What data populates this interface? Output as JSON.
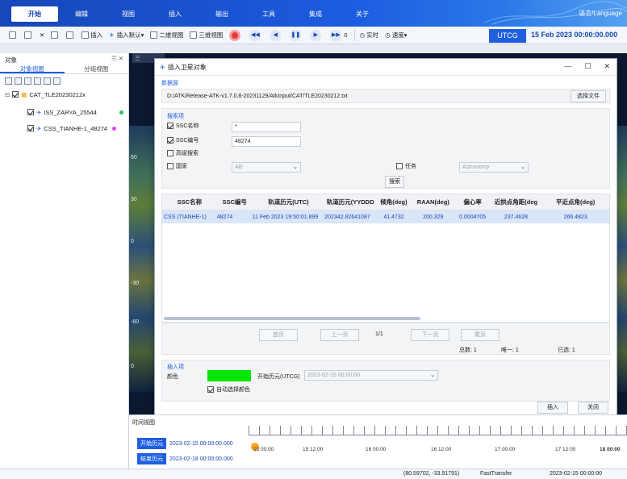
{
  "menubar": {
    "tabs": [
      "开始",
      "编辑",
      "视图",
      "插入",
      "输出",
      "工具",
      "集成",
      "关于"
    ],
    "active_tab": "开始",
    "language_label": "语言/Language"
  },
  "toolbar": {
    "insert_label": "插入",
    "insert_default_label": "插入默认▾",
    "view2d_label": "二维视图",
    "view3d_label": "三维视图",
    "step_value": "0",
    "realtime_label": "实时",
    "speed_label": "速度▾",
    "time_system": "UTCG",
    "current_time": "15 Feb 2023 00:00:00.000"
  },
  "object_panel": {
    "title": "对象",
    "tabs": [
      "对象视图",
      "分组视图"
    ],
    "tree": {
      "catalog": "CAT_TLE20230212x",
      "items": [
        {
          "name": "ISS_ZARYA_25544",
          "color": "#22c55e"
        },
        {
          "name": "CSS_TIANHE-1_48274",
          "color": "#d946ef"
        }
      ]
    }
  },
  "viewport": {
    "tab": "三",
    "lat_labels": [
      "60",
      "30",
      "0",
      "-30",
      "-60",
      "0"
    ]
  },
  "dialog": {
    "title": "插入卫星对象",
    "datasource": {
      "section": "数据源",
      "path": "D:/ATK/Release-ATK-v1.7.0.8-20231129/AtkInput/CAT/TLE20230212.txt",
      "choose_file": "选择文件"
    },
    "search": {
      "section": "搜索项",
      "ssc_name_label": "SSC名称",
      "ssc_name_value": "*",
      "ssc_number_label": "SSC编号",
      "ssc_number_value": "48274",
      "advanced_label": "高级搜索",
      "country_label": "国家",
      "country_value": "AB",
      "mission_label": "任务",
      "mission_value": "Astronomy",
      "search_button": "搜索"
    },
    "table": {
      "columns": [
        "SSC名称",
        "SSC编号",
        "轨道历元(UTC)",
        "轨道历元(YYDDD",
        "倾角(deg)",
        "RAAN(deg)",
        "偏心率",
        "近拱点角距(deg",
        "平近点角(deg)"
      ],
      "rows": [
        [
          "CSS (TIANHE-1)",
          "48274",
          "11 Feb 2023 19:50:01.899",
          "202342.82641087",
          "41.4732",
          "200.329",
          "0.0004705",
          "237.4628",
          "266.4823"
        ]
      ]
    },
    "pager": {
      "first": "首页",
      "prev": "上一页",
      "page": "1/1",
      "next": "下一页",
      "last": "尾页",
      "total_label": "总数:",
      "total_value": "1",
      "unique_label": "唯一:",
      "unique_value": "1",
      "selected_label": "已选:",
      "selected_value": "1"
    },
    "insert": {
      "section": "插入项",
      "color_label": "颜色",
      "color_value": "#00e600",
      "start_epoch_label": "开始历元(UTCG)",
      "start_epoch_value": "2023-02-15 00:00:00",
      "auto_color_label": "自动选择颜色"
    },
    "buttons": {
      "insert": "插入",
      "close": "关闭"
    }
  },
  "timeline": {
    "title": "时间视图",
    "start_label": "开始历元",
    "start_value": "2023-02-15 00:00:00.000",
    "end_label": "结束历元",
    "end_value": "2023-02-18 00:00:00.000",
    "ticks": [
      "15 00:00",
      "15 12:00",
      "16 00:00",
      "16 12:00",
      "17 00:00",
      "17 12:00",
      "18 00:00"
    ]
  },
  "statusbar": {
    "coords": "(80.59702, -33.91791)",
    "mode": "FastTransfer",
    "time": "2023-02-15 00:00:00"
  }
}
